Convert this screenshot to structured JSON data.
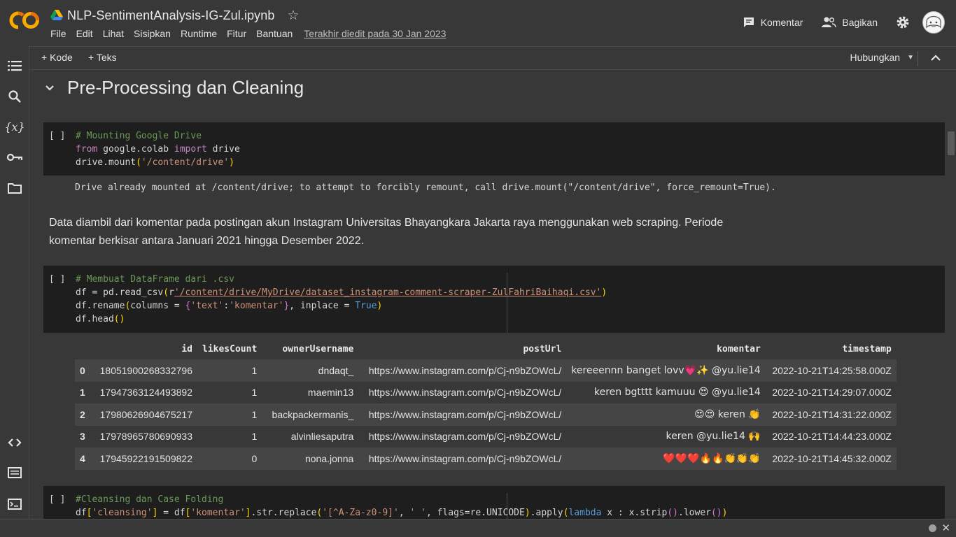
{
  "header": {
    "notebook_title": "NLP-SentimentAnalysis-IG-Zul.ipynb",
    "menu": [
      "File",
      "Edit",
      "Lihat",
      "Sisipkan",
      "Runtime",
      "Fitur",
      "Bantuan"
    ],
    "last_edited": "Terakhir diedit pada 30 Jan 2023",
    "comment_label": "Komentar",
    "share_label": "Bagikan",
    "logo_text": "CO"
  },
  "toolbar": {
    "add_code": "+ Kode",
    "add_text": "+ Teks",
    "connect": "Hubungkan"
  },
  "sidebar": {
    "icons": [
      "table-of-contents-icon",
      "search-icon",
      "variables-icon",
      "secrets-key-icon",
      "folder-icon",
      "code-snippets-icon",
      "command-palette-icon",
      "terminal-icon"
    ]
  },
  "section": {
    "title": "Pre-Processing dan Cleaning"
  },
  "cells": {
    "run_indicator": "[ ]",
    "cell1": {
      "line1_comment": "# Mounting Google Drive",
      "line2_from": "from",
      "line2_mod": " google.colab ",
      "line2_import": "import",
      "line2_name": " drive",
      "line3_pre": "drive.mount",
      "line3_open": "(",
      "line3_str": "'/content/drive'",
      "line3_close": ")",
      "output": "Drive already mounted at /content/drive; to attempt to forcibly remount, call drive.mount(\"/content/drive\", force_remount=True)."
    },
    "markdown": "Data diambil dari komentar pada postingan akun Instagram Universitas Bhayangkara Jakarta raya menggunakan web scraping. Periode komentar berkisar antara Januari 2021 hingga Desember 2022.",
    "cell2": {
      "line1_comment": "# Membuat DataFrame dari .csv",
      "line2_pre": "df = pd.read_csv",
      "line2_open": "(",
      "line2_r": "r",
      "line2_str": "'/content/drive/MyDrive/dataset_instagram-comment-scraper-ZulFahriBaihaqi.csv'",
      "line2_close": ")",
      "line3_pre": "df.rename",
      "line3_open": "(",
      "line3_mid": "columns = ",
      "line3_bopen": "{",
      "line3_k": "'text'",
      "line3_colon": ":",
      "line3_v": "'komentar'",
      "line3_bclose": "}",
      "line3_rest": ", inplace = ",
      "line3_true": "True",
      "line3_close": ")",
      "line4_pre": "df.head",
      "line4_paren": "()"
    },
    "cell3": {
      "line1_comment": "#Cleansing dan Case Folding",
      "line2_a": "df",
      "line2_b1": "[",
      "line2_s1": "'cleansing'",
      "line2_b2": "]",
      "line2_c": " = df",
      "line2_b3": "[",
      "line2_s2": "'komentar'",
      "line2_b4": "]",
      "line2_d": ".str.replace",
      "line2_p1": "(",
      "line2_s3": "'[^A-Za-z0-9]'",
      "line2_e": ", ",
      "line2_s4": "' '",
      "line2_f": ", flags=re.UNICODE",
      "line2_p2": ")",
      "line2_g": ".apply",
      "line2_p3": "(",
      "line2_kw": "lambda",
      "line2_h": " x : x.strip",
      "line2_p4": "()",
      "line2_i": ".lower",
      "line2_p5": "()",
      "line2_p6": ")"
    }
  },
  "dataframe": {
    "columns": [
      "",
      "id",
      "likesCount",
      "ownerUsername",
      "postUrl",
      "komentar",
      "timestamp"
    ],
    "rows": [
      [
        "0",
        "18051900268332796",
        "1",
        "dndaqt_",
        "https://www.instagram.com/p/Cj-n9bZOWcL/",
        "kereeennn banget lovv💗✨ @yu.lie14",
        "2022-10-21T14:25:58.000Z"
      ],
      [
        "1",
        "17947363124493892",
        "1",
        "maemin13",
        "https://www.instagram.com/p/Cj-n9bZOWcL/",
        "keren bgtttt kamuuu 😍 @yu.lie14",
        "2022-10-21T14:29:07.000Z"
      ],
      [
        "2",
        "17980626904675217",
        "1",
        "backpackermanis_",
        "https://www.instagram.com/p/Cj-n9bZOWcL/",
        "😍😍 keren 👏",
        "2022-10-21T14:31:22.000Z"
      ],
      [
        "3",
        "17978965780690933",
        "1",
        "alvinliesaputra",
        "https://www.instagram.com/p/Cj-n9bZOWcL/",
        "keren @yu.lie14 🙌",
        "2022-10-21T14:44:23.000Z"
      ],
      [
        "4",
        "17945922191509822",
        "0",
        "nona.jonna",
        "https://www.instagram.com/p/Cj-n9bZOWcL/",
        "❤️❤️❤️🔥🔥👏👏👏",
        "2022-10-21T14:45:32.000Z"
      ]
    ]
  }
}
